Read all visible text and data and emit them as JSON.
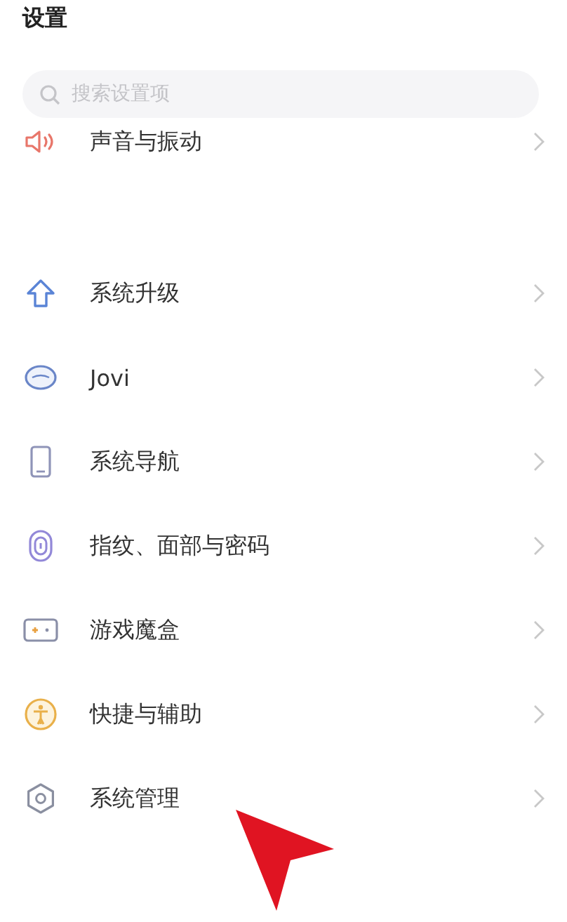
{
  "title": "设置",
  "search": {
    "placeholder": "搜索设置项"
  },
  "groups": [
    {
      "items": [
        {
          "kind": "sound",
          "label": "声音与振动"
        }
      ]
    },
    {
      "items": [
        {
          "kind": "upgrade",
          "label": "系统升级"
        },
        {
          "kind": "assistant",
          "label": "Jovi"
        },
        {
          "kind": "phone",
          "label": "系统导航"
        },
        {
          "kind": "fingerprint",
          "label": "指纹、面部与密码"
        },
        {
          "kind": "game",
          "label": "游戏魔盒"
        },
        {
          "kind": "accessibility",
          "label": "快捷与辅助"
        },
        {
          "kind": "hexagon",
          "label": "系统管理"
        }
      ]
    }
  ]
}
